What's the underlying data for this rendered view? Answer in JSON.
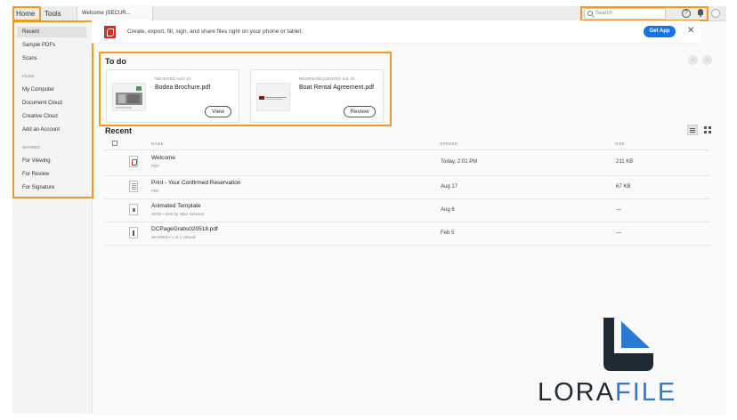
{
  "colors": {
    "accent_orange": "#f29a1e",
    "acrobat_red": "#e4271a",
    "primary_blue": "#1473e6",
    "logo_dark": "#1f2a33",
    "logo_blue": "#2a79d4"
  },
  "topbar": {
    "tabs": [
      {
        "label": "Home",
        "active": true
      },
      {
        "label": "Tools",
        "active": false
      }
    ],
    "doc_tab": "Welcome (SECUR...",
    "search_placeholder": "Search",
    "icons": [
      "search-icon",
      "help-icon",
      "bell-icon",
      "avatar"
    ]
  },
  "sidebar": {
    "items": [
      {
        "label": "Recent",
        "active": true
      },
      {
        "label": "Sample PDFs"
      },
      {
        "label": "Scans"
      }
    ],
    "files_heading": "FILES",
    "file_items": [
      {
        "label": "My Computer"
      },
      {
        "label": "Document Cloud"
      },
      {
        "label": "Creative Cloud"
      },
      {
        "label": "Add an Account"
      }
    ],
    "shared_heading": "SHARED",
    "shared_items": [
      {
        "label": "For Viewing"
      },
      {
        "label": "For Review"
      },
      {
        "label": "For Signature"
      }
    ]
  },
  "banner": {
    "text": "Create, export, fill, sign, and share files right on your phone or tablet.",
    "button": "Get App",
    "close": "✕"
  },
  "todo": {
    "title": "To do",
    "cards": [
      {
        "kicker": "RECEIVED AUG 10",
        "name": "Bodea Brochure.pdf",
        "button": "View"
      },
      {
        "kicker": "REVIEW REQUESTED JUL 20",
        "name": "Boat Rental Agreement.pdf",
        "button": "Review"
      }
    ]
  },
  "recent": {
    "title": "Recent",
    "columns": {
      "name": "NAME",
      "opened": "OPENED",
      "size": "SIZE"
    },
    "rows": [
      {
        "name": "Welcome",
        "sub": "PDF",
        "opened": "Today, 2:01 PM",
        "size": "211 KB",
        "icon": "pdf-file-icon"
      },
      {
        "name": "Print - Your Confirmed Reservation",
        "sub": "PDF",
        "opened": "Aug 17",
        "size": "67 KB",
        "icon": "document-file-icon"
      },
      {
        "name": "Animated Template",
        "sub": "SIGN • Sent by Jake Johnson",
        "opened": "Aug 6",
        "size": "—",
        "icon": "template-file-icon"
      },
      {
        "name": "DCPageGrabs020518.pdf",
        "sub": "SHARED • 1 of 1 viewed",
        "opened": "Feb 5",
        "size": "—",
        "icon": "shared-file-icon"
      }
    ]
  },
  "watermark": {
    "part1": "LORA",
    "part2": "FILE"
  }
}
